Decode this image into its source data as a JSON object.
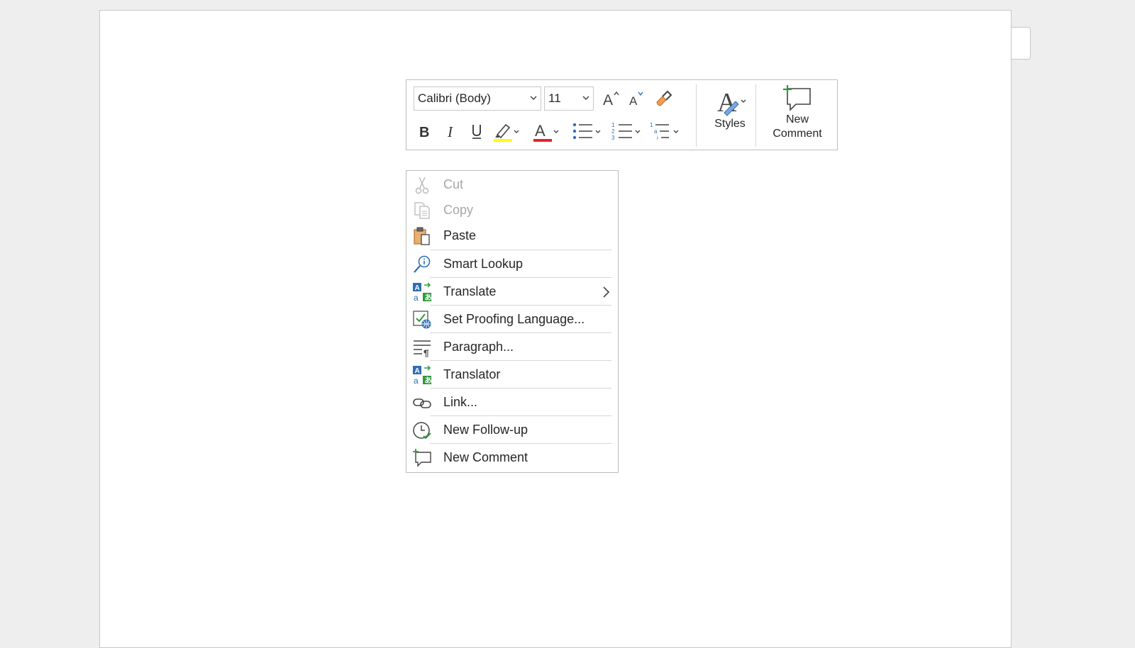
{
  "mini_toolbar": {
    "font_name": "Calibri (Body)",
    "font_size": "11",
    "buttons": {
      "grow_font": "grow-font",
      "shrink_font": "shrink-font",
      "format_painter": "format-painter",
      "bold": "bold",
      "italic": "italic",
      "underline": "underline",
      "highlight": "highlight",
      "font_color": "font-color",
      "bullets": "bullets",
      "numbering": "numbering",
      "multilevel": "multilevel-list"
    },
    "highlight_color": "#ffff00",
    "font_color_value": "#e3242b",
    "styles_label": "Styles",
    "new_comment_line1": "New",
    "new_comment_line2": "Comment"
  },
  "context_menu": {
    "items": [
      {
        "label": "Cut",
        "icon": "scissors-icon",
        "enabled": false
      },
      {
        "label": "Copy",
        "icon": "copy-icon",
        "enabled": false
      },
      {
        "label": "Paste",
        "icon": "paste-icon",
        "enabled": true
      },
      {
        "label": "Smart Lookup",
        "icon": "smart-lookup-icon",
        "enabled": true
      },
      {
        "label": "Translate",
        "icon": "translate-icon",
        "enabled": true,
        "submenu": true
      },
      {
        "label": "Set Proofing Language...",
        "icon": "proofing-language-icon",
        "enabled": true
      },
      {
        "label": "Paragraph...",
        "icon": "paragraph-icon",
        "enabled": true
      },
      {
        "label": "Translator",
        "icon": "translator-icon",
        "enabled": true
      },
      {
        "label": "Link...",
        "icon": "link-icon",
        "enabled": true
      },
      {
        "label": "New Follow-up",
        "icon": "follow-up-icon",
        "enabled": true
      },
      {
        "label": "New Comment",
        "icon": "new-comment-icon",
        "enabled": true
      }
    ]
  }
}
